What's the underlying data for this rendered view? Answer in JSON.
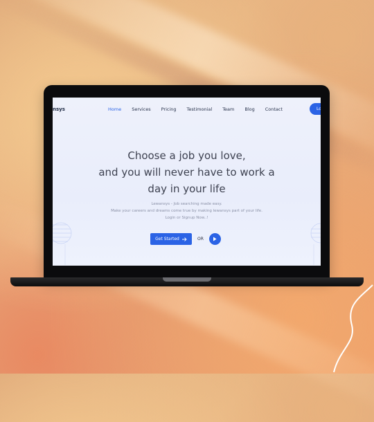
{
  "website": {
    "brand": "nsys",
    "nav": [
      {
        "label": "Home",
        "active": true
      },
      {
        "label": "Services"
      },
      {
        "label": "Pricing"
      },
      {
        "label": "Testimonial"
      },
      {
        "label": "Team"
      },
      {
        "label": "Blog"
      },
      {
        "label": "Contact"
      }
    ],
    "login_label": "Lo",
    "hero": {
      "title_lines": [
        "Choose a job you love,",
        "and you will never have to work a",
        "day in your life"
      ],
      "desc_lines": [
        "Lewansys - Job searching made easy.",
        "Make your careers and dreams come true by making lewansys part of your life.",
        "Login or Signup Now..!"
      ],
      "cta_label": "Get Started",
      "or_label": "OR"
    }
  },
  "icons": {
    "cta_arrow": "arrow-right-icon",
    "play": "play-icon"
  },
  "colors": {
    "accent": "#2b63e5",
    "text_dark": "#3d4150",
    "text_muted": "#8a90a6"
  }
}
